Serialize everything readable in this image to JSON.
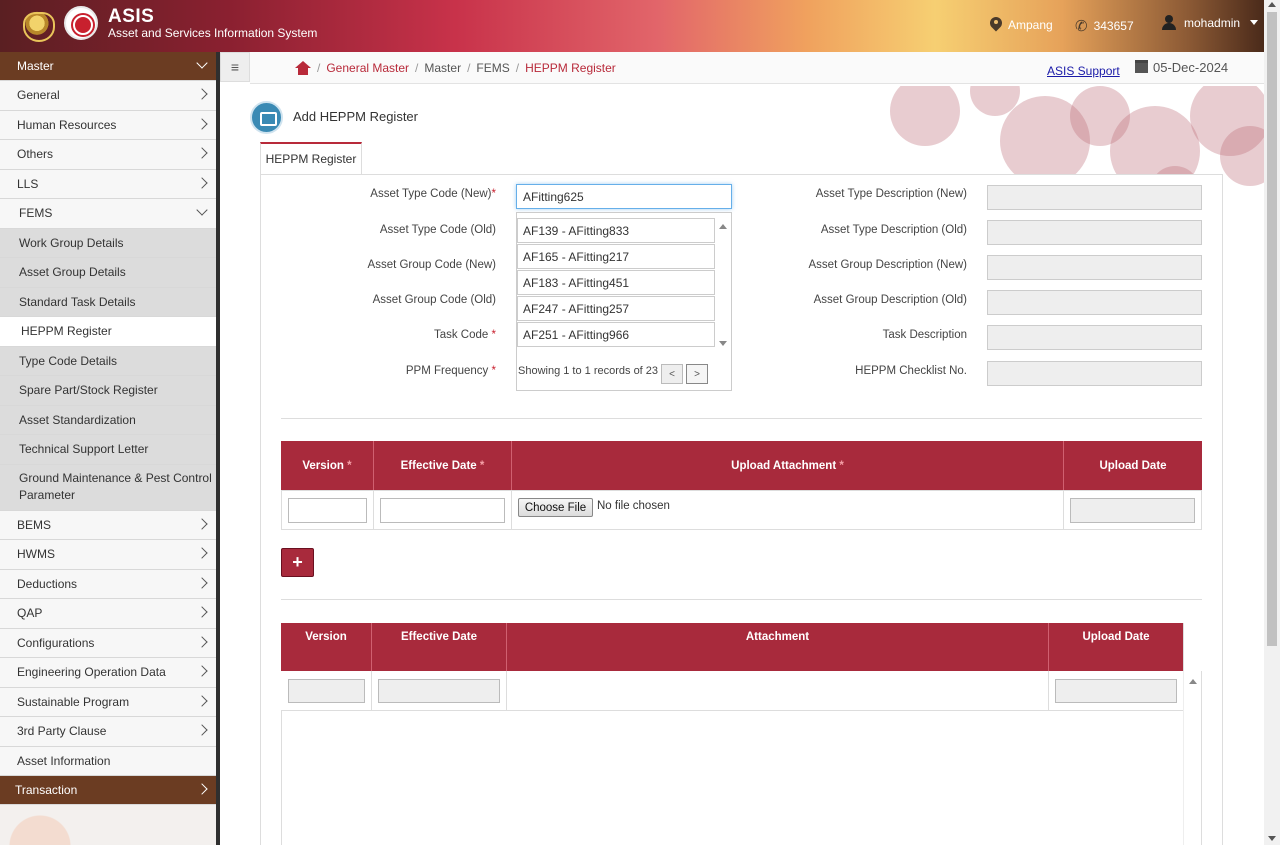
{
  "header": {
    "brand_title": "ASIS",
    "brand_subtitle": "Asset and Services Information System",
    "location": "Ampang",
    "phone": "343657",
    "user": "mohadmin"
  },
  "sidebar": {
    "master": "Master",
    "items": [
      {
        "label": "General"
      },
      {
        "label": "Human Resources"
      },
      {
        "label": "Others"
      },
      {
        "label": "LLS"
      },
      {
        "label": "FEMS"
      }
    ],
    "fems_sub": [
      {
        "label": "Work Group Details"
      },
      {
        "label": "Asset Group Details"
      },
      {
        "label": "Standard Task Details"
      },
      {
        "label": "HEPPM Register"
      },
      {
        "label": "Type Code Details"
      },
      {
        "label": "Spare Part/Stock Register"
      },
      {
        "label": "Asset Standardization"
      },
      {
        "label": "Technical Support Letter"
      },
      {
        "label": "Ground Maintenance & Pest Control Parameter"
      }
    ],
    "items_after": [
      {
        "label": "BEMS"
      },
      {
        "label": "HWMS"
      },
      {
        "label": "Deductions"
      },
      {
        "label": "QAP"
      },
      {
        "label": "Configurations"
      },
      {
        "label": "Engineering Operation Data"
      },
      {
        "label": "Sustainable Program"
      },
      {
        "label": "3rd Party Clause"
      },
      {
        "label": "Asset Information"
      }
    ],
    "transaction": "Transaction"
  },
  "breadcrumb": {
    "items": [
      "General Master",
      "Master",
      "FEMS",
      "HEPPM Register"
    ],
    "support": "ASIS Support",
    "date": "05-Dec-2024"
  },
  "page": {
    "title": "Add HEPPM Register",
    "tab": "HEPPM Register"
  },
  "form": {
    "asset_type_code_new_label": "Asset Type Code (New)",
    "asset_type_code_new_value": "AFitting625",
    "asset_type_code_old_label": "Asset Type Code (Old)",
    "asset_group_code_new_label": "Asset Group Code (New)",
    "asset_group_code_old_label": "Asset Group Code (Old)",
    "task_code_label": "Task Code",
    "ppm_frequency_label": "PPM Frequency",
    "asset_type_desc_new_label": "Asset Type Description (New)",
    "asset_type_desc_old_label": "Asset Type Description (Old)",
    "asset_group_desc_new_label": "Asset Group Description (New)",
    "asset_group_desc_old_label": "Asset Group Description (Old)",
    "task_desc_label": "Task Description",
    "checklist_label": "HEPPM Checklist No.",
    "required_mark": "*"
  },
  "dropdown": {
    "options": [
      "AF139 - AFitting833",
      "AF165 - AFitting217",
      "AF183 - AFitting451",
      "AF247 - AFitting257",
      "AF251 - AFitting966"
    ],
    "footer": "Showing 1 to 1 records of 23",
    "prev": "<",
    "next": ">"
  },
  "upload_table": {
    "headers": [
      "Version",
      "Effective Date",
      "Upload Attachment",
      "Upload Date"
    ],
    "choose_file": "Choose File",
    "no_file": "No file chosen",
    "add": "+"
  },
  "list_table": {
    "headers": [
      "Version",
      "Effective Date",
      "Attachment",
      "Upload Date"
    ]
  }
}
